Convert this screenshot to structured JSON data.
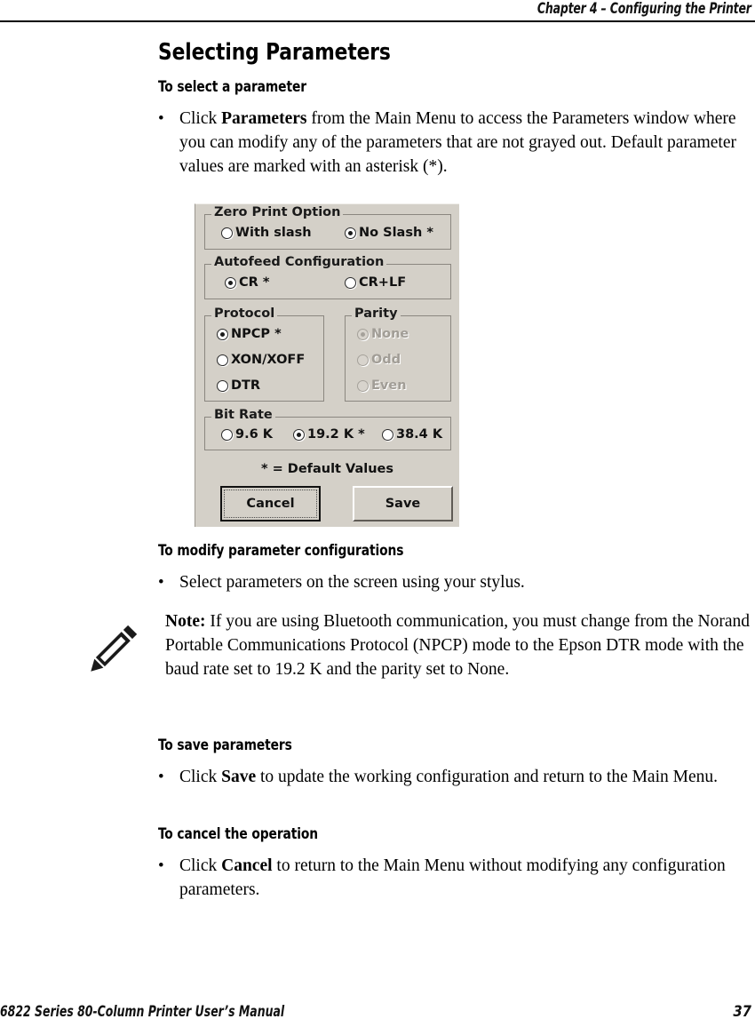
{
  "header": {
    "chapter": "Chapter 4 – Configuring the Printer"
  },
  "footer": {
    "manual_title": "6822 Series 80-Column Printer User’s Manual",
    "page_number": "37"
  },
  "section": {
    "title": "Selecting Parameters"
  },
  "blocks": {
    "select_heading": "To select a parameter",
    "select_bullet_prefix": "Click ",
    "select_bullet_bold": "Parameters",
    "select_bullet_suffix": " from the Main Menu to access the Parameters window where you can modify any of the parameters that are not grayed out. Default parameter values are marked with an asterisk (*).",
    "modify_heading": "To modify parameter configurations",
    "modify_bullet": "Select parameters on the screen using your stylus.",
    "note_label": "Note:",
    "note_text": " If you are using Bluetooth communication, you must change from the Norand Portable Communications Protocol (NPCP) mode to the Epson DTR mode with the baud rate set to 19.2 K and the parity set to None.",
    "save_heading": "To save parameters",
    "save_bullet_prefix": "Click ",
    "save_bullet_bold": "Save",
    "save_bullet_suffix": " to update the working configuration and return to the Main Menu.",
    "cancel_heading": "To cancel the operation",
    "cancel_bullet_prefix": "Click ",
    "cancel_bullet_bold": "Cancel",
    "cancel_bullet_suffix": " to return to the Main Menu without modifying any configuration parameters."
  },
  "dialog": {
    "background_color": "#d4d0c8",
    "groups": {
      "zero_print": {
        "label": "Zero Print Option",
        "options": [
          {
            "label": "With slash",
            "checked": false,
            "enabled": true
          },
          {
            "label": "No Slash *",
            "checked": true,
            "enabled": true
          }
        ]
      },
      "autofeed": {
        "label": "Autofeed Configuration",
        "options": [
          {
            "label": "CR *",
            "checked": true,
            "enabled": true
          },
          {
            "label": "CR+LF",
            "checked": false,
            "enabled": true
          }
        ]
      },
      "protocol": {
        "label": "Protocol",
        "options": [
          {
            "label": "NPCP *",
            "checked": true,
            "enabled": true
          },
          {
            "label": "XON/XOFF",
            "checked": false,
            "enabled": true
          },
          {
            "label": "DTR",
            "checked": false,
            "enabled": true
          }
        ]
      },
      "parity": {
        "label": "Parity",
        "enabled": false,
        "options": [
          {
            "label": "None",
            "checked": true,
            "enabled": false
          },
          {
            "label": "Odd",
            "checked": false,
            "enabled": false
          },
          {
            "label": "Even",
            "checked": false,
            "enabled": false
          }
        ]
      },
      "bit_rate": {
        "label": "Bit Rate",
        "options": [
          {
            "label": "9.6 K",
            "checked": false,
            "enabled": true
          },
          {
            "label": "19.2 K *",
            "checked": true,
            "enabled": true
          },
          {
            "label": "38.4 K",
            "checked": false,
            "enabled": true
          }
        ]
      }
    },
    "legend": "* = Default Values",
    "buttons": {
      "cancel": "Cancel",
      "save": "Save"
    }
  }
}
